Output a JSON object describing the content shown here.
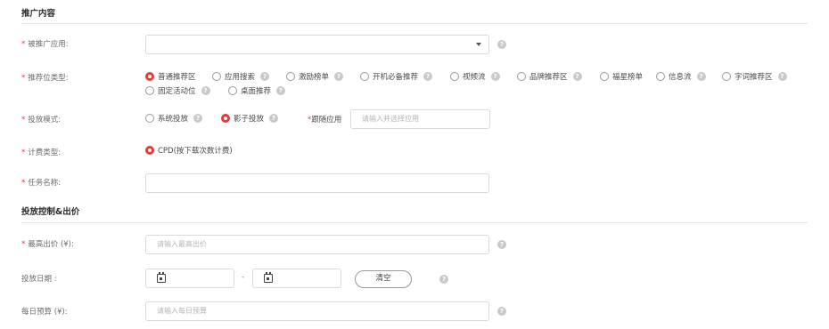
{
  "sections": {
    "promo_content": "推广内容",
    "bid_control": "投放控制&出价"
  },
  "fields": {
    "app": {
      "label": "被推广应用:",
      "value": ""
    },
    "slot_type": {
      "label": "推荐位类型:",
      "options": [
        "普通推荐区",
        "应用搜索",
        "激励榜单",
        "开机必备推荐",
        "视频流",
        "品牌推荐区",
        "福星榜单",
        "信息流",
        "字词推荐区",
        "固定活动位",
        "桌面推荐"
      ],
      "selected": "普通推荐区"
    },
    "mode": {
      "label": "投放模式:",
      "options": [
        "系统投放",
        "影子投放"
      ],
      "selected": "影子投放",
      "follow_label": "跟随应用",
      "follow_placeholder": "请输入并选择应用"
    },
    "billing": {
      "label": "计费类型:",
      "option": "CPD(按下载次数计费)"
    },
    "task_name": {
      "label": "任务名称:",
      "value": ""
    },
    "max_bid": {
      "label": "最高出价 (¥):",
      "placeholder": "请输入最高出价"
    },
    "date": {
      "label": "投放日期 :",
      "separator": "-",
      "clear_label": "清空"
    },
    "daily_budget": {
      "label": "每日预算 (¥):",
      "placeholder": "请输入每日预算"
    }
  },
  "required_mark": "*",
  "icons": {
    "help": "help-icon",
    "calendar": "calendar-icon",
    "caret": "caret-down-icon"
  },
  "colors": {
    "accent": "#e53b3b",
    "border": "#d9d9d9",
    "help": "#c9c9c9"
  }
}
